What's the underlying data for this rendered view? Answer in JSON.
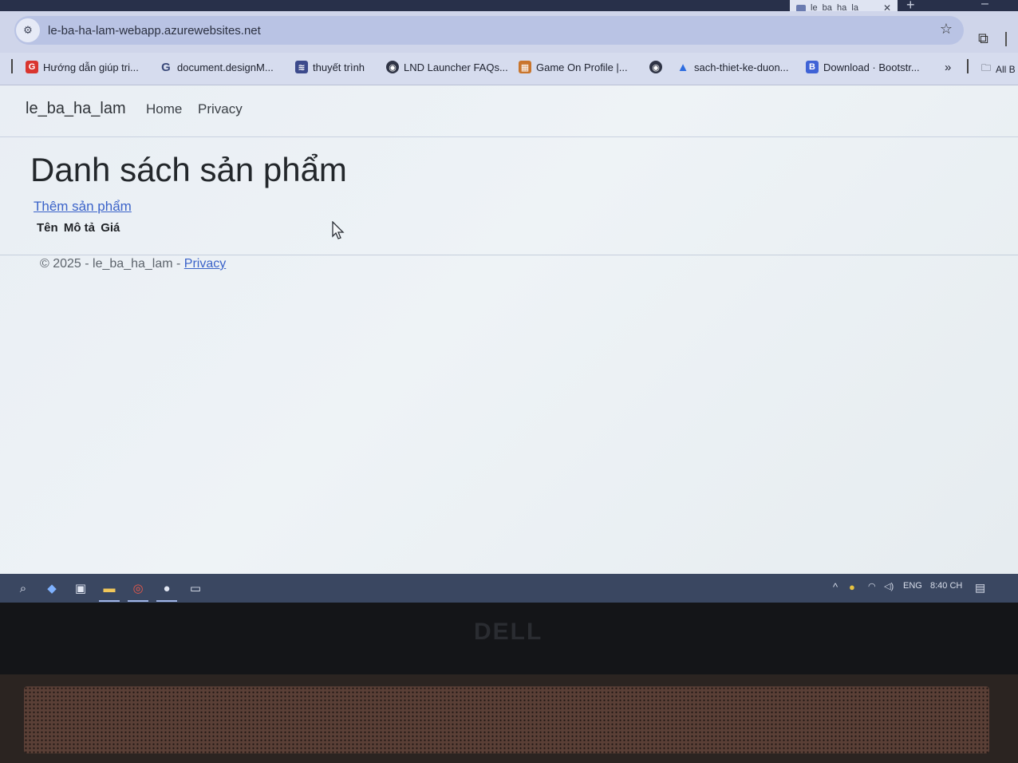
{
  "browser": {
    "tab_title": "le_ba_ha_la",
    "url": "le-ba-ha-lam-webapp.azurewebsites.net",
    "bookmarks": [
      {
        "label": "Hướng dẫn giúp tri...",
        "icon": "g-red-icon"
      },
      {
        "label": "document.designM...",
        "icon": "google-icon"
      },
      {
        "label": "thuyết trình",
        "icon": "stack-icon"
      },
      {
        "label": "LND Launcher FAQs...",
        "icon": "globe-icon"
      },
      {
        "label": "Game On Profile |...",
        "icon": "game-icon"
      },
      {
        "label": "",
        "icon": "globe-icon"
      },
      {
        "label": "sach-thiet-ke-duon...",
        "icon": "drive-icon"
      },
      {
        "label": "Download · Bootstr...",
        "icon": "bootstrap-icon"
      }
    ],
    "more_bookmarks": "»",
    "all_bookmarks": "All B"
  },
  "page": {
    "brand": "le_ba_ha_lam",
    "nav": [
      "Home",
      "Privacy"
    ],
    "title": "Danh sách sản phẩm",
    "add_link": "Thêm sản phẩm",
    "table_headers": [
      "Tên",
      "Mô tả",
      "Giá"
    ],
    "footer_text": "© 2025 - le_ba_ha_lam - ",
    "footer_link": "Privacy"
  },
  "taskbar": {
    "language": "ENG",
    "time": "8:40 CH"
  },
  "device": {
    "logo": "DELL"
  }
}
